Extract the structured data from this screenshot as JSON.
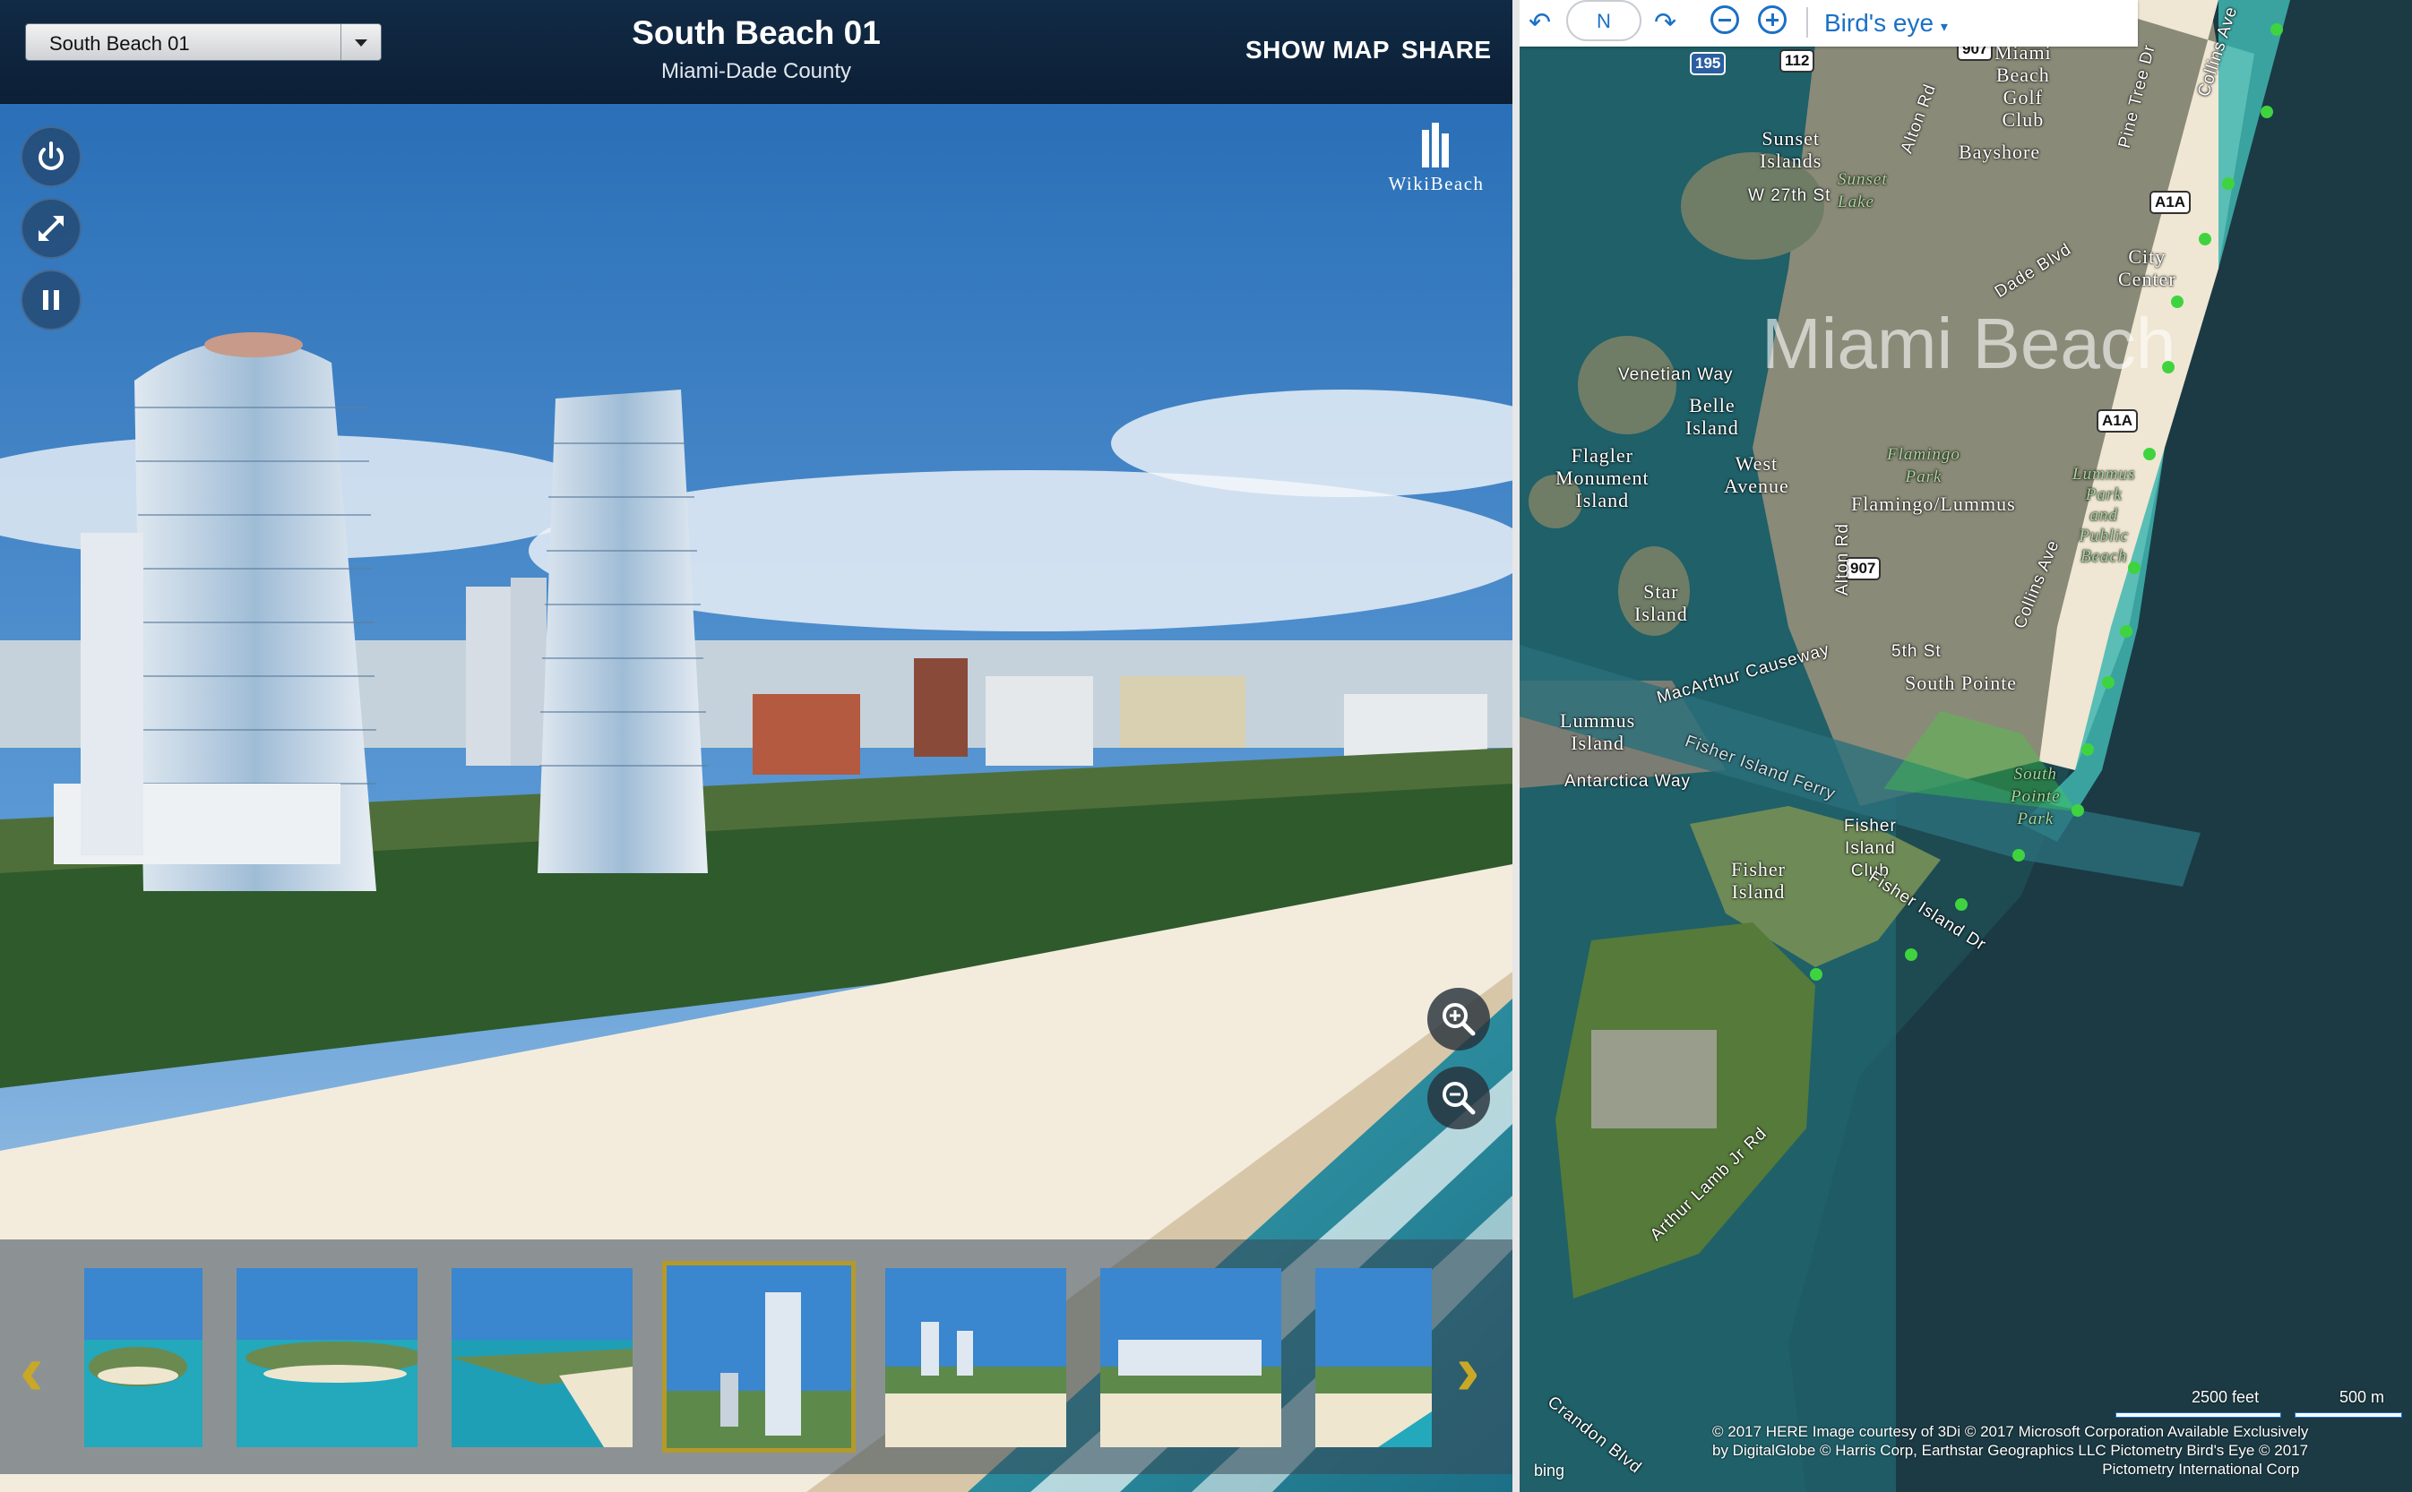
{
  "header": {
    "location_select": "South Beach 01",
    "title": "South Beach 01",
    "subtitle": "Miami-Dade County",
    "show_map": "SHOW MAP",
    "share": "SHARE"
  },
  "logo": {
    "text": "WikiBeach"
  },
  "controls": {
    "power_icon": "power-icon",
    "fullscreen_icon": "expand-icon",
    "pause_icon": "pause-icon",
    "zoom_in_icon": "zoom-in-icon",
    "zoom_out_icon": "zoom-out-icon"
  },
  "thumbnails": {
    "count": 7,
    "selected_index": 3,
    "prev_icon": "chevron-left-icon",
    "next_icon": "chevron-right-icon"
  },
  "map": {
    "toolbar": {
      "compass": "N",
      "mode": "Bird's eye"
    },
    "city_label": "Miami Beach",
    "labels": {
      "miami_beach_golf": [
        "Miami",
        "Beach",
        "Golf",
        "Club"
      ],
      "bayshore": "Bayshore",
      "sunset_islands": [
        "Sunset",
        "Islands"
      ],
      "sunset_lake": [
        "Sunset",
        "Lake"
      ],
      "w27th": "W 27th St",
      "dade_blvd": "Dade Blvd",
      "city_center": [
        "City",
        "Center"
      ],
      "venetian_way": "Venetian Way",
      "belle_island": [
        "Belle",
        "Island"
      ],
      "flagler": [
        "Flagler",
        "Monument",
        "Island"
      ],
      "west_avenue": [
        "West",
        "Avenue"
      ],
      "flamingo_park": [
        "Flamingo",
        "Park"
      ],
      "flamingo_lummus": "Flamingo/Lummus",
      "lummus_park": [
        "Lummus",
        "Park",
        "and",
        "Public",
        "Beach"
      ],
      "star_island": [
        "Star",
        "Island"
      ],
      "fifth_st": "5th St",
      "south_pointe": "South Pointe",
      "macarthur": "MacArthur Causeway",
      "lummus_island": [
        "Lummus",
        "Island"
      ],
      "antarctica": "Antarctica Way",
      "fisher_ferry": "Fisher Island Ferry",
      "south_pointe_park": [
        "South",
        "Pointe",
        "Park"
      ],
      "fisher_island": [
        "Fisher",
        "Island"
      ],
      "fisher_island_club": [
        "Fisher",
        "Island",
        "Club"
      ],
      "fisher_island_dr": "Fisher Island Dr",
      "alton_rd": "Alton Rd",
      "alton_rd2": "Alton Rd",
      "collins_ave": "Collins Ave",
      "collins_ave2": "Collins Ave",
      "pine_tree": "Pine Tree Dr",
      "arthur_lamb": "Arthur Lamb Jr Rd",
      "crandon": "Crandon Blvd"
    },
    "shields": {
      "i195": "195",
      "r112": "112",
      "r907a": "907",
      "r907b": "907",
      "a1a_1": "A1A",
      "a1a_2": "A1A"
    },
    "copyright": [
      "© 2017 HERE    Image courtesy of 3Di    © 2017 Microsoft Corporation    Available Exclusively",
      "by DigitalGlobe    © Harris Corp, Earthstar Geographics LLC    Pictometry Bird's Eye © 2017",
      "Pictometry International Corp"
    ],
    "scale_feet": "2500 feet",
    "scale_m": "500 m",
    "bing": "bing"
  }
}
